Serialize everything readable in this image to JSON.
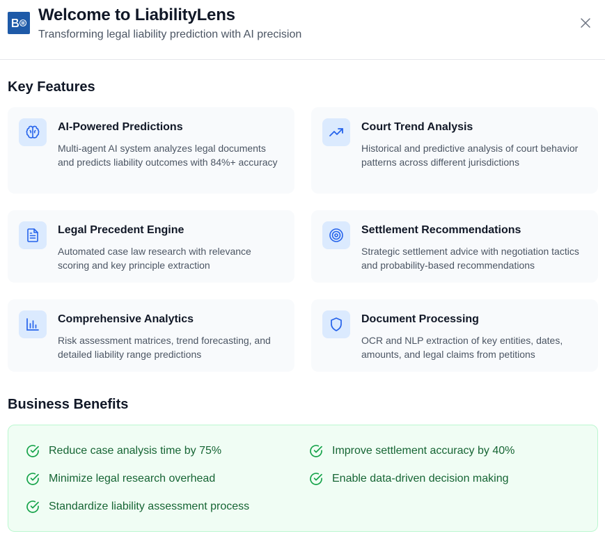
{
  "header": {
    "title": "Welcome to LiabilityLens",
    "subtitle": "Transforming legal liability prediction with AI precision",
    "logo_icon": "app-logo-icon",
    "close_icon": "close-icon"
  },
  "features": {
    "heading": "Key Features",
    "items": [
      {
        "icon": "brain-icon",
        "title": "AI-Powered Predictions",
        "description": "Multi-agent AI system analyzes legal documents and predicts liability outcomes with 84%+ accuracy"
      },
      {
        "icon": "trending-up-icon",
        "title": "Court Trend Analysis",
        "description": "Historical and predictive analysis of court behavior patterns across different jurisdictions"
      },
      {
        "icon": "document-icon",
        "title": "Legal Precedent Engine",
        "description": "Automated case law research with relevance scoring and key principle extraction"
      },
      {
        "icon": "target-icon",
        "title": "Settlement Recommendations",
        "description": "Strategic settlement advice with negotiation tactics and probability-based recommendations"
      },
      {
        "icon": "bar-chart-icon",
        "title": "Comprehensive Analytics",
        "description": "Risk assessment matrices, trend forecasting, and detailed liability range predictions"
      },
      {
        "icon": "shield-icon",
        "title": "Document Processing",
        "description": "OCR and NLP extraction of key entities, dates, amounts, and legal claims from petitions"
      }
    ]
  },
  "benefits": {
    "heading": "Business Benefits",
    "items": [
      "Reduce case analysis time by 75%",
      "Improve settlement accuracy by 40%",
      "Minimize legal research overhead",
      "Enable data-driven decision making",
      "Standardize liability assessment process"
    ]
  },
  "colors": {
    "accent": "#2563eb",
    "icon_bg": "#dbeafe",
    "card_bg": "#f8fafc",
    "success": "#16a34a",
    "success_text": "#166534",
    "success_bg": "#f0fdf4"
  }
}
